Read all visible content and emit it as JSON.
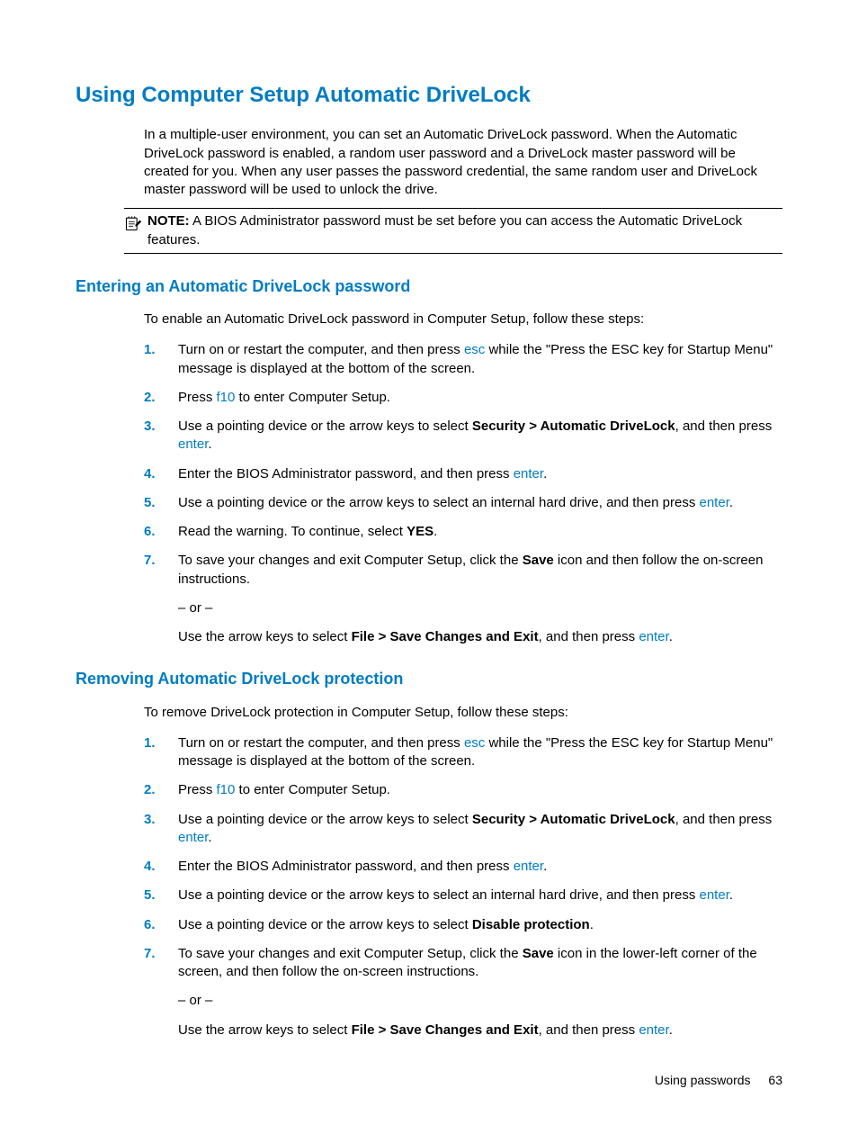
{
  "heading": "Using Computer Setup Automatic DriveLock",
  "intro": "In a multiple-user environment, you can set an Automatic DriveLock password. When the Automatic DriveLock password is enabled, a random user password and a DriveLock master password will be created for you. When any user passes the password credential, the same random user and DriveLock master password will be used to unlock the drive.",
  "note": {
    "label": "NOTE:",
    "text": "A BIOS Administrator password must be set before you can access the Automatic DriveLock features."
  },
  "section1": {
    "heading": "Entering an Automatic DriveLock password",
    "intro": "To enable an Automatic DriveLock password in Computer Setup, follow these steps:",
    "steps": {
      "s1a": "Turn on or restart the computer, and then press ",
      "s1k": "esc",
      "s1b": " while the \"Press the ESC key for Startup Menu\" message is displayed at the bottom of the screen.",
      "s2a": "Press ",
      "s2k": "f10",
      "s2b": " to enter Computer Setup.",
      "s3a": "Use a pointing device or the arrow keys to select ",
      "s3bold": "Security > Automatic DriveLock",
      "s3b": ", and then press ",
      "s3k": "enter",
      "s3c": ".",
      "s4a": "Enter the BIOS Administrator password, and then press ",
      "s4k": "enter",
      "s4b": ".",
      "s5a": "Use a pointing device or the arrow keys to select an internal hard drive, and then press ",
      "s5k": "enter",
      "s5b": ".",
      "s6a": "Read the warning. To continue, select ",
      "s6bold": "YES",
      "s6b": ".",
      "s7a": "To save your changes and exit Computer Setup, click the ",
      "s7bold": "Save",
      "s7b": " icon and then follow the on-screen instructions.",
      "s7or": "– or –",
      "s7c": "Use the arrow keys to select ",
      "s7bold2": "File > Save Changes and Exit",
      "s7d": ", and then press ",
      "s7k": "enter",
      "s7e": "."
    }
  },
  "section2": {
    "heading": "Removing Automatic DriveLock protection",
    "intro": "To remove DriveLock protection in Computer Setup, follow these steps:",
    "steps": {
      "s1a": "Turn on or restart the computer, and then press ",
      "s1k": "esc",
      "s1b": " while the \"Press the ESC key for Startup Menu\" message is displayed at the bottom of the screen.",
      "s2a": "Press ",
      "s2k": "f10",
      "s2b": " to enter Computer Setup.",
      "s3a": "Use a pointing device or the arrow keys to select ",
      "s3bold": "Security > Automatic DriveLock",
      "s3b": ", and then press ",
      "s3k": "enter",
      "s3c": ".",
      "s4a": "Enter the BIOS Administrator password, and then press ",
      "s4k": "enter",
      "s4b": ".",
      "s5a": "Use a pointing device or the arrow keys to select an internal hard drive, and then press ",
      "s5k": "enter",
      "s5b": ".",
      "s6a": "Use a pointing device or the arrow keys to select ",
      "s6bold": "Disable protection",
      "s6b": ".",
      "s7a": "To save your changes and exit Computer Setup, click the ",
      "s7bold": "Save",
      "s7b": " icon in the lower-left corner of the screen, and then follow the on-screen instructions.",
      "s7or": "– or –",
      "s7c": "Use the arrow keys to select ",
      "s7bold2": "File > Save Changes and Exit",
      "s7d": ", and then press ",
      "s7k": "enter",
      "s7e": "."
    }
  },
  "footer": {
    "label": "Using passwords",
    "page": "63"
  }
}
